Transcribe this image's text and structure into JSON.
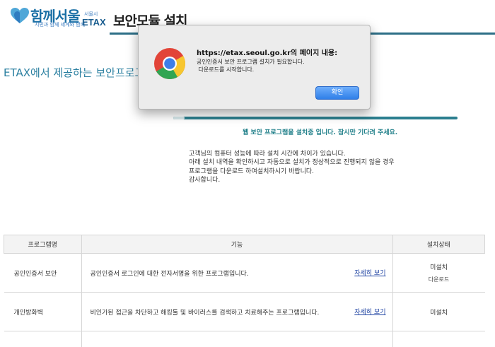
{
  "header": {
    "logo_main": "함께서울",
    "logo_sub": "시민과 함께 세계와 함께",
    "logo_city": "서울시",
    "logo_etax": "ETAX",
    "page_title": "보안모듈 설치"
  },
  "intro": {
    "heading": "ETAX에서 제공하는 보안프로그램"
  },
  "progress": {
    "fraction": 0.04,
    "message": "웹 보안 프로그램을 설치중 입니다. 잠시만 기다려 주세요."
  },
  "notice": {
    "lines": [
      "고객님의 컴퓨터 성능에 따라 설치 시간에 차이가 있습니다.",
      "아래 설치 내역을 확인하시고 자동으로 설치가 정상적으로 진행되지 않을 경우",
      "프로그램을 다운로드 하여설치하시기 바랍니다.",
      "감사합니다."
    ]
  },
  "table": {
    "headers": [
      "프로그램명",
      "기능",
      "설치상태"
    ],
    "rows": [
      {
        "name": "공인인증서 보안",
        "function": "공인인증서 로그인에 대한 전자서명을 위한 프로그램입니다.",
        "link": "자세히 보기",
        "status": "미설치",
        "status_sub": "다운로드"
      },
      {
        "name": "개인방화벽",
        "function": "비인가된 접근을 차단하고 해킹툴 및 바이러스를 검색하고 치료해주는 프로그램입니다.",
        "link": "자세히 보기",
        "status": "미설치",
        "status_sub": ""
      }
    ]
  },
  "dialog": {
    "title": "https://etax.seoul.go.kr의 페이지 내용:",
    "body_lines": [
      "공인인증서 보안 프로그램 설치가 필요합니다.",
      " 다운로드를 시작합니다."
    ],
    "ok_label": "확인",
    "icon": "chrome-icon"
  },
  "colors": {
    "accent": "#2d6f87",
    "teal_text": "#1e7e88",
    "link": "#1a3fa0",
    "button": "#3b86ef"
  }
}
